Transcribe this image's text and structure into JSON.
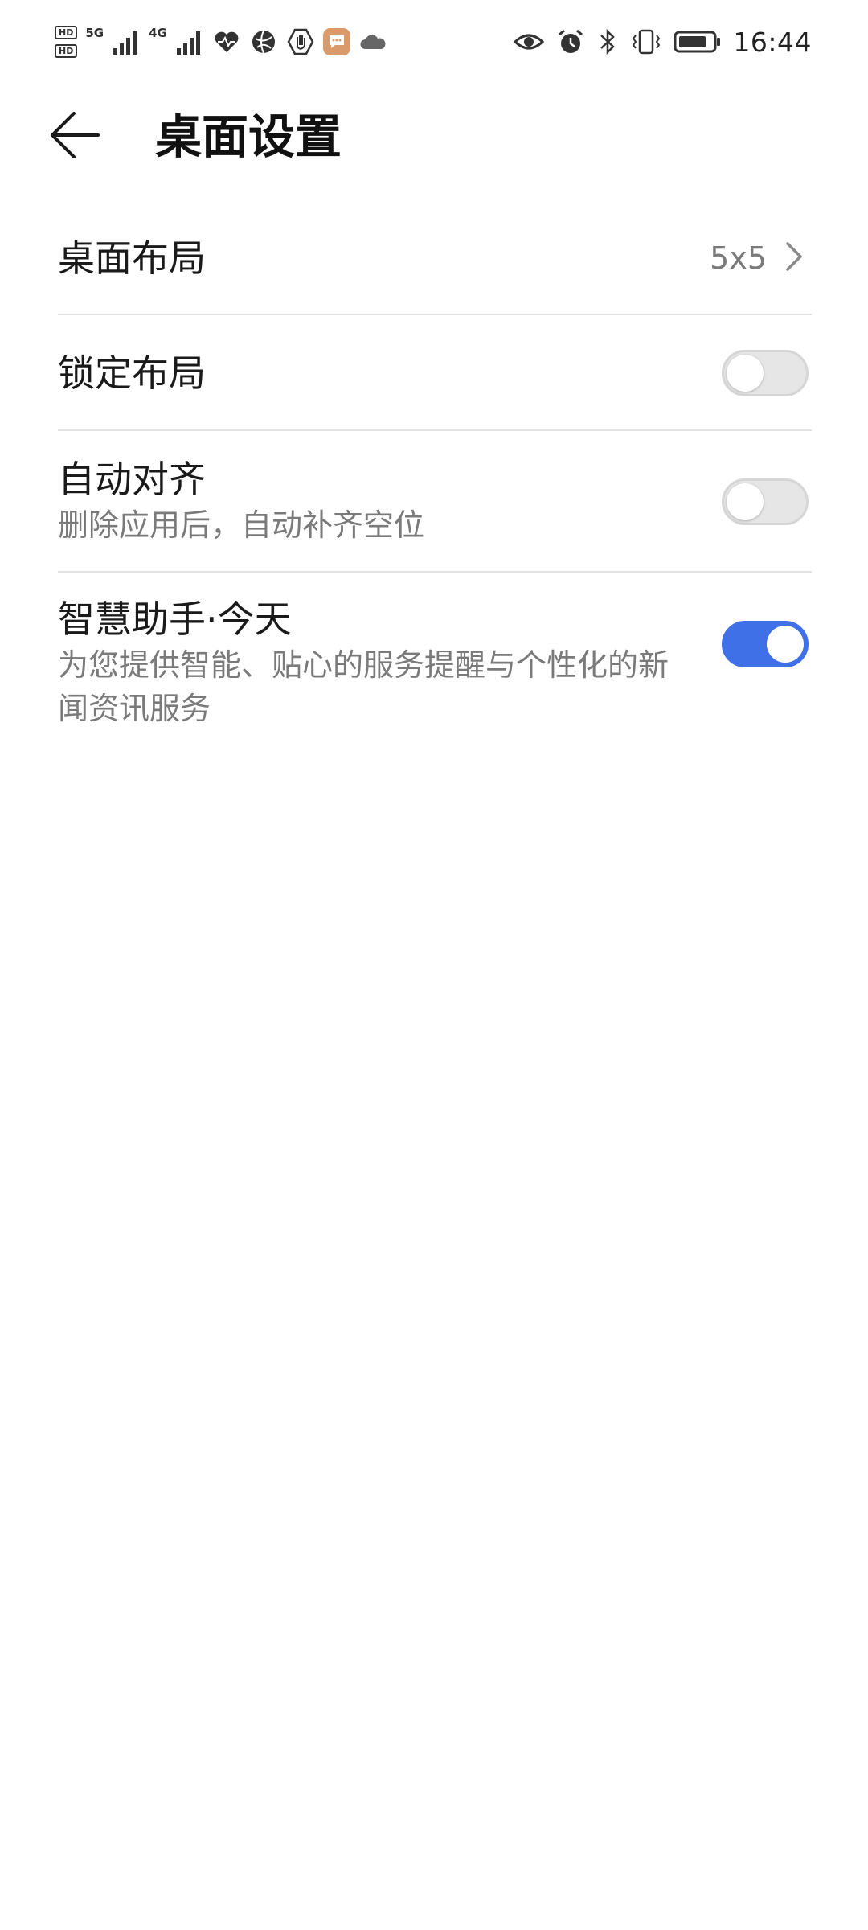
{
  "status_bar": {
    "hd_badges": [
      "HD",
      "HD"
    ],
    "network_1": "5G",
    "network_2": "4G",
    "time": "16:44",
    "left_icons": [
      "hd-icon",
      "signal-5g-icon",
      "signal-4g-icon",
      "health-icon",
      "browser-icon",
      "hand-icon",
      "message-icon",
      "cloud-icon"
    ],
    "right_icons": [
      "eye-icon",
      "alarm-icon",
      "bluetooth-icon",
      "vibrate-icon",
      "battery-icon"
    ]
  },
  "header": {
    "back_icon": "back-arrow-icon",
    "title": "桌面设置"
  },
  "settings": {
    "layout": {
      "title": "桌面布局",
      "value": "5x5",
      "icon": "chevron-right-icon"
    },
    "lock_layout": {
      "title": "锁定布局",
      "enabled": false
    },
    "auto_align": {
      "title": "自动对齐",
      "subtitle": "删除应用后，自动补齐空位",
      "enabled": false
    },
    "smart_assistant": {
      "title": "智慧助手·今天",
      "subtitle": "为您提供智能、贴心的服务提醒与个性化的新闻资讯服务",
      "enabled": true
    }
  },
  "colors": {
    "accent": "#3f70e8",
    "toggle_off": "#e6e6e6",
    "secondary_text": "#7a7a7a",
    "divider": "#e2e2e2",
    "message_icon_bg": "#d99a6c"
  }
}
